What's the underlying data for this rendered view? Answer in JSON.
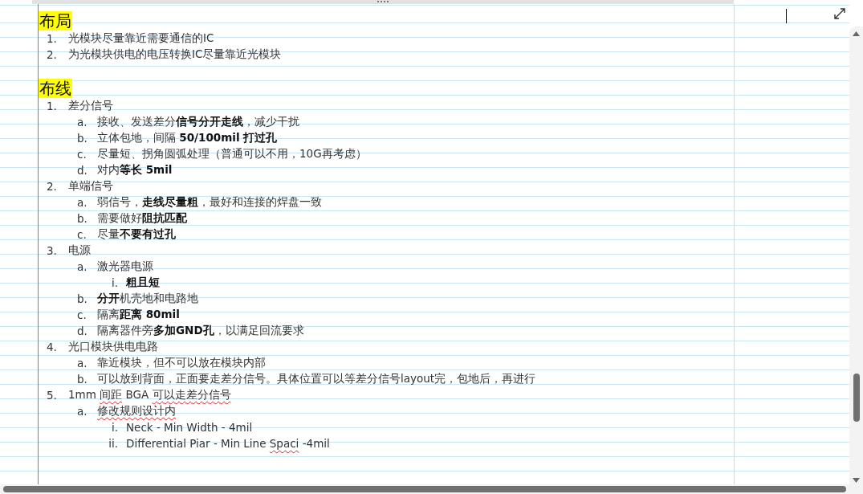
{
  "sections": [
    {
      "heading": "布局",
      "items": [
        {
          "marker": "1.",
          "segments": [
            {
              "text": "光模块尽量靠近需要通信的IC",
              "flagged": false
            }
          ]
        },
        {
          "marker": "2.",
          "segments": [
            {
              "text": "为光模块供电的电压转换IC尽量靠近光模块",
              "flagged": false
            }
          ]
        }
      ]
    },
    {
      "heading": "布线",
      "items": [
        {
          "marker": "1.",
          "segments": [
            {
              "text": "差分信号",
              "flagged": false
            }
          ],
          "children": [
            {
              "marker": "a.",
              "segments": [
                {
                  "text": "接收、发送差分**信号分开走线**，减少干扰",
                  "flagged": false
                }
              ]
            },
            {
              "marker": "b.",
              "segments": [
                {
                  "text": "立体包地，间隔 **50/100mil 打过孔**",
                  "flagged": false
                }
              ]
            },
            {
              "marker": "c.",
              "segments": [
                {
                  "text": "尽量短、拐角圆弧处理（普通可以不用，10G再考虑）",
                  "flagged": false
                }
              ]
            },
            {
              "marker": "d.",
              "segments": [
                {
                  "text": "对内**等长 5mil**",
                  "flagged": false
                }
              ]
            }
          ]
        },
        {
          "marker": "2.",
          "segments": [
            {
              "text": "单端信号",
              "flagged": false
            }
          ],
          "children": [
            {
              "marker": "a.",
              "segments": [
                {
                  "text": "弱信号，**走线尽量粗**，最好和连接的焊盘一致",
                  "flagged": false
                }
              ]
            },
            {
              "marker": "b.",
              "segments": [
                {
                  "text": "需要做好**阻抗匹配**",
                  "flagged": false
                }
              ]
            },
            {
              "marker": "c.",
              "segments": [
                {
                  "text": "尽量**不要有过孔**",
                  "flagged": false
                }
              ]
            }
          ]
        },
        {
          "marker": "3.",
          "segments": [
            {
              "text": "电源",
              "flagged": false
            }
          ],
          "children": [
            {
              "marker": "a.",
              "segments": [
                {
                  "text": "激光器电源",
                  "flagged": false
                }
              ],
              "children": [
                {
                  "marker": "i.",
                  "segments": [
                    {
                      "text": "**粗且短**",
                      "flagged": false
                    }
                  ]
                }
              ]
            },
            {
              "marker": "b.",
              "segments": [
                {
                  "text": "**分开**机壳地和电路地",
                  "flagged": false
                }
              ]
            },
            {
              "marker": "c.",
              "segments": [
                {
                  "text": "隔离**距离 80mil**",
                  "flagged": false
                }
              ]
            },
            {
              "marker": "d.",
              "segments": [
                {
                  "text": "隔离器件旁**多加GND孔**，以满足回流要求",
                  "flagged": false
                }
              ]
            }
          ]
        },
        {
          "marker": "4.",
          "segments": [
            {
              "text": "光口模块供电电路",
              "flagged": false
            }
          ],
          "children": [
            {
              "marker": "a.",
              "segments": [
                {
                  "text": "靠近模块，但不可以放在模块内部",
                  "flagged": false
                }
              ]
            },
            {
              "marker": "b.",
              "segments": [
                {
                  "text": "可以放到背面，正面要走差分信号。具体位置可以等差分信号layout完，包地后，再进行",
                  "flagged": false
                }
              ]
            }
          ]
        },
        {
          "marker": "5.",
          "segments": [
            {
              "text": "1mm ",
              "flagged": false
            },
            {
              "text": "间距",
              "flagged": true
            },
            {
              "text": " BGA ",
              "flagged": false
            },
            {
              "text": "可以走差分信号",
              "flagged": true
            }
          ],
          "children": [
            {
              "marker": "a.",
              "segments": [
                {
                  "text": "修改规则设计内",
                  "flagged": true
                }
              ],
              "children": [
                {
                  "marker": "i.",
                  "segments": [
                    {
                      "text": "Neck - Min Width - 4mil",
                      "flagged": false
                    }
                  ]
                },
                {
                  "marker": "ii.",
                  "segments": [
                    {
                      "text": "Differential Piar - Min Line ",
                      "flagged": false
                    },
                    {
                      "text": "Spaci",
                      "flagged": true
                    },
                    {
                      "text": " -4mil",
                      "flagged": false
                    }
                  ]
                }
              ]
            }
          ]
        }
      ]
    }
  ]
}
